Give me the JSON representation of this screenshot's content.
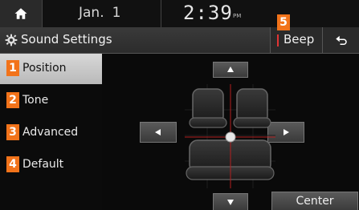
{
  "status": {
    "date_month": "Jan.",
    "date_day": "1",
    "time": "2:39",
    "ampm": "PM"
  },
  "titlebar": {
    "title": "Sound Settings",
    "beep_label": "Beep"
  },
  "callouts": {
    "beep": "5"
  },
  "menu": {
    "items": [
      {
        "num": "1",
        "label": "Position",
        "active": true
      },
      {
        "num": "2",
        "label": "Tone"
      },
      {
        "num": "3",
        "label": "Advanced"
      },
      {
        "num": "4",
        "label": "Default"
      }
    ]
  },
  "panel": {
    "center_label": "Center"
  },
  "colors": {
    "accent_orange": "#f2731a",
    "beep_indicator": "#e23434"
  },
  "icons": [
    "home-icon",
    "gear-icon",
    "back-icon",
    "arrow-up-icon",
    "arrow-down-icon",
    "arrow-left-icon",
    "arrow-right-icon"
  ]
}
